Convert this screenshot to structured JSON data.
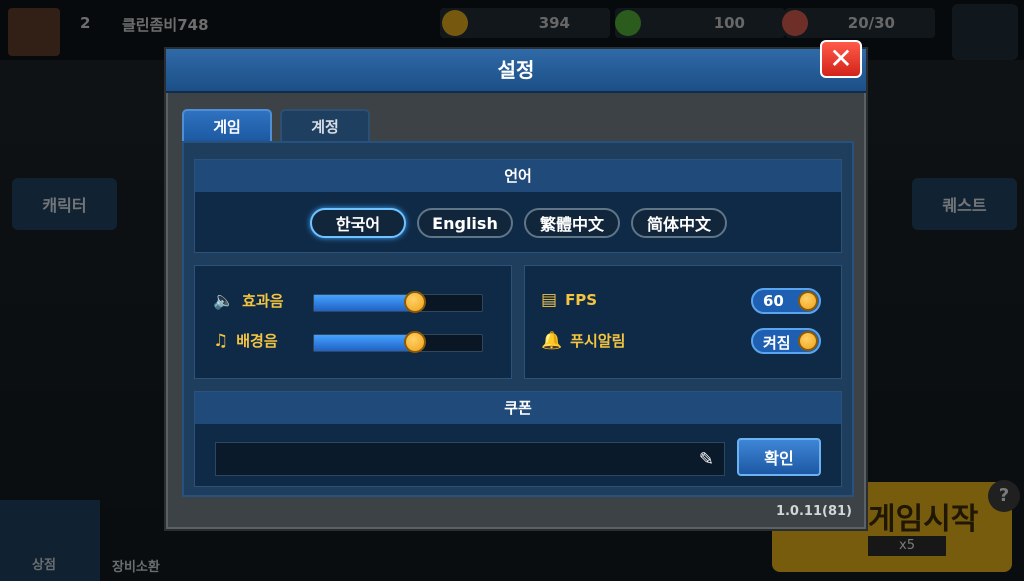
{
  "background": {
    "player_level": "2",
    "player_name": "클린좀비748",
    "res1": "394",
    "res2": "100",
    "res3": "20/30",
    "left_button": "캐릭터",
    "right_button": "퀘스트",
    "shop_label": "상점",
    "equip_label": "장비소환",
    "start_label": "게임시작",
    "start_count": "x5",
    "help_text": "?"
  },
  "dialog": {
    "title": "설정",
    "close_icon": "close-x-icon",
    "tabs": [
      {
        "label": "게임",
        "active": true
      },
      {
        "label": "계정",
        "active": false
      }
    ],
    "language": {
      "heading": "언어",
      "options": [
        {
          "label": "한국어",
          "selected": true
        },
        {
          "label": "English",
          "selected": false
        },
        {
          "label": "繁體中文",
          "selected": false
        },
        {
          "label": "简体中文",
          "selected": false
        }
      ]
    },
    "audio": {
      "sfx_label": "효과음",
      "sfx_level": 0.6,
      "bgm_label": "배경음",
      "bgm_level": 0.6
    },
    "options": {
      "fps_label": "FPS",
      "fps_value": "60",
      "push_label": "푸시알림",
      "push_value": "켜짐"
    },
    "coupon": {
      "heading": "쿠폰",
      "placeholder": "",
      "confirm_label": "확인"
    },
    "version": "1.0.11(81)"
  },
  "colors": {
    "accent_yellow": "#f5c542",
    "header_blue": "#2f6aa8",
    "close_red": "#d3241a"
  }
}
